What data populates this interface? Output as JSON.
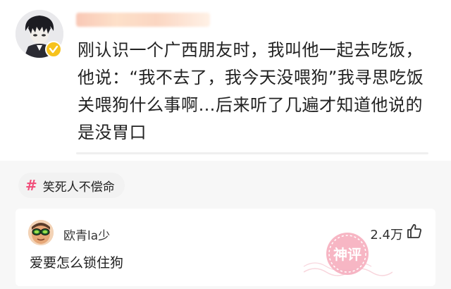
{
  "post": {
    "text": "刚认识一个广西朋友时，我叫他一起去吃饭，他说：“我不去了，我今天没喂狗”我寻思吃饭关喂狗什么事啊…后来听了几遍才知道他说的是没胃口"
  },
  "topic": {
    "label": "笑死人不偿命",
    "accent": "#f14f7b"
  },
  "comment": {
    "username": "欧青la少",
    "likes": "2.4万",
    "text": "爱要怎么锁住狗"
  },
  "watermark": {
    "text": "神评"
  },
  "colors": {
    "badge": "#f6c21c",
    "watermark": "#f07a94"
  }
}
